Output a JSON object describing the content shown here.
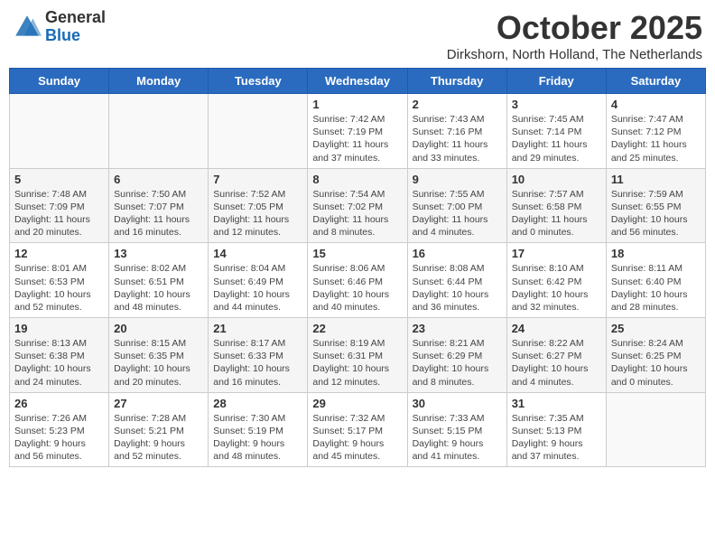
{
  "header": {
    "logo_general": "General",
    "logo_blue": "Blue",
    "month_title": "October 2025",
    "location": "Dirkshorn, North Holland, The Netherlands"
  },
  "days_of_week": [
    "Sunday",
    "Monday",
    "Tuesday",
    "Wednesday",
    "Thursday",
    "Friday",
    "Saturday"
  ],
  "weeks": [
    [
      {
        "day": "",
        "info": ""
      },
      {
        "day": "",
        "info": ""
      },
      {
        "day": "",
        "info": ""
      },
      {
        "day": "1",
        "info": "Sunrise: 7:42 AM\nSunset: 7:19 PM\nDaylight: 11 hours and 37 minutes."
      },
      {
        "day": "2",
        "info": "Sunrise: 7:43 AM\nSunset: 7:16 PM\nDaylight: 11 hours and 33 minutes."
      },
      {
        "day": "3",
        "info": "Sunrise: 7:45 AM\nSunset: 7:14 PM\nDaylight: 11 hours and 29 minutes."
      },
      {
        "day": "4",
        "info": "Sunrise: 7:47 AM\nSunset: 7:12 PM\nDaylight: 11 hours and 25 minutes."
      }
    ],
    [
      {
        "day": "5",
        "info": "Sunrise: 7:48 AM\nSunset: 7:09 PM\nDaylight: 11 hours and 20 minutes."
      },
      {
        "day": "6",
        "info": "Sunrise: 7:50 AM\nSunset: 7:07 PM\nDaylight: 11 hours and 16 minutes."
      },
      {
        "day": "7",
        "info": "Sunrise: 7:52 AM\nSunset: 7:05 PM\nDaylight: 11 hours and 12 minutes."
      },
      {
        "day": "8",
        "info": "Sunrise: 7:54 AM\nSunset: 7:02 PM\nDaylight: 11 hours and 8 minutes."
      },
      {
        "day": "9",
        "info": "Sunrise: 7:55 AM\nSunset: 7:00 PM\nDaylight: 11 hours and 4 minutes."
      },
      {
        "day": "10",
        "info": "Sunrise: 7:57 AM\nSunset: 6:58 PM\nDaylight: 11 hours and 0 minutes."
      },
      {
        "day": "11",
        "info": "Sunrise: 7:59 AM\nSunset: 6:55 PM\nDaylight: 10 hours and 56 minutes."
      }
    ],
    [
      {
        "day": "12",
        "info": "Sunrise: 8:01 AM\nSunset: 6:53 PM\nDaylight: 10 hours and 52 minutes."
      },
      {
        "day": "13",
        "info": "Sunrise: 8:02 AM\nSunset: 6:51 PM\nDaylight: 10 hours and 48 minutes."
      },
      {
        "day": "14",
        "info": "Sunrise: 8:04 AM\nSunset: 6:49 PM\nDaylight: 10 hours and 44 minutes."
      },
      {
        "day": "15",
        "info": "Sunrise: 8:06 AM\nSunset: 6:46 PM\nDaylight: 10 hours and 40 minutes."
      },
      {
        "day": "16",
        "info": "Sunrise: 8:08 AM\nSunset: 6:44 PM\nDaylight: 10 hours and 36 minutes."
      },
      {
        "day": "17",
        "info": "Sunrise: 8:10 AM\nSunset: 6:42 PM\nDaylight: 10 hours and 32 minutes."
      },
      {
        "day": "18",
        "info": "Sunrise: 8:11 AM\nSunset: 6:40 PM\nDaylight: 10 hours and 28 minutes."
      }
    ],
    [
      {
        "day": "19",
        "info": "Sunrise: 8:13 AM\nSunset: 6:38 PM\nDaylight: 10 hours and 24 minutes."
      },
      {
        "day": "20",
        "info": "Sunrise: 8:15 AM\nSunset: 6:35 PM\nDaylight: 10 hours and 20 minutes."
      },
      {
        "day": "21",
        "info": "Sunrise: 8:17 AM\nSunset: 6:33 PM\nDaylight: 10 hours and 16 minutes."
      },
      {
        "day": "22",
        "info": "Sunrise: 8:19 AM\nSunset: 6:31 PM\nDaylight: 10 hours and 12 minutes."
      },
      {
        "day": "23",
        "info": "Sunrise: 8:21 AM\nSunset: 6:29 PM\nDaylight: 10 hours and 8 minutes."
      },
      {
        "day": "24",
        "info": "Sunrise: 8:22 AM\nSunset: 6:27 PM\nDaylight: 10 hours and 4 minutes."
      },
      {
        "day": "25",
        "info": "Sunrise: 8:24 AM\nSunset: 6:25 PM\nDaylight: 10 hours and 0 minutes."
      }
    ],
    [
      {
        "day": "26",
        "info": "Sunrise: 7:26 AM\nSunset: 5:23 PM\nDaylight: 9 hours and 56 minutes."
      },
      {
        "day": "27",
        "info": "Sunrise: 7:28 AM\nSunset: 5:21 PM\nDaylight: 9 hours and 52 minutes."
      },
      {
        "day": "28",
        "info": "Sunrise: 7:30 AM\nSunset: 5:19 PM\nDaylight: 9 hours and 48 minutes."
      },
      {
        "day": "29",
        "info": "Sunrise: 7:32 AM\nSunset: 5:17 PM\nDaylight: 9 hours and 45 minutes."
      },
      {
        "day": "30",
        "info": "Sunrise: 7:33 AM\nSunset: 5:15 PM\nDaylight: 9 hours and 41 minutes."
      },
      {
        "day": "31",
        "info": "Sunrise: 7:35 AM\nSunset: 5:13 PM\nDaylight: 9 hours and 37 minutes."
      },
      {
        "day": "",
        "info": ""
      }
    ]
  ]
}
